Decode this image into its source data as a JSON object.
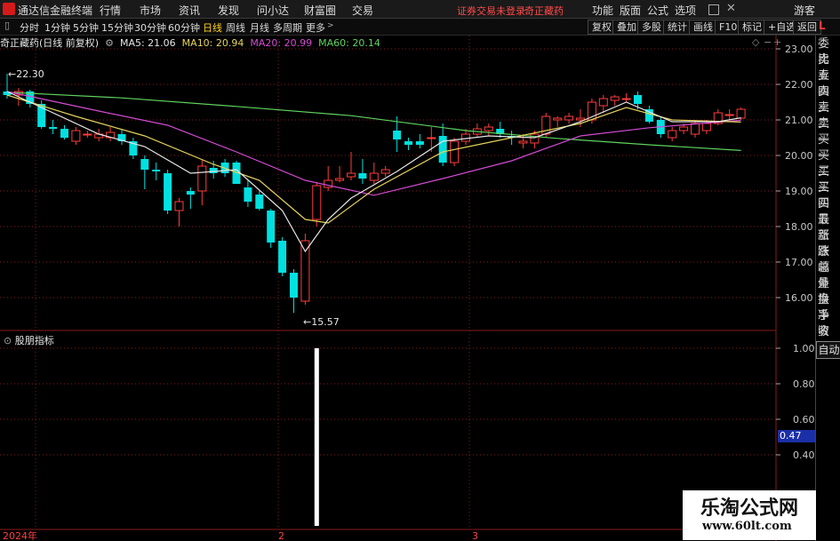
{
  "menubar": {
    "app_name": "通达信金融终端",
    "items": [
      "行情",
      "市场",
      "资讯",
      "发现",
      "问小达",
      "财富圈",
      "交易"
    ],
    "status_text": "证券交易未登录",
    "stock_name": "奇正藏药",
    "right_items": [
      "功能",
      "版面",
      "公式",
      "选项"
    ],
    "guest": "游客"
  },
  "periodbar": {
    "periods": [
      "分时",
      "1分钟",
      "5分钟",
      "15分钟",
      "30分钟",
      "60分钟",
      "日线",
      "周线",
      "月线",
      "多周期",
      "更多"
    ],
    "active": "日线",
    "tools": [
      "复权",
      "叠加",
      "多股",
      "统计",
      "画线",
      "F10",
      "标记",
      "+自选",
      "返回"
    ]
  },
  "chart_header": {
    "title": "奇正藏药(日线 前复权)",
    "ma5": "MA5: 21.06",
    "ma10": "MA10: 20.94",
    "ma20": "MA20: 20.99",
    "ma60": "MA60: 20.14"
  },
  "sidepanel": {
    "marker": "L",
    "items": [
      "委比",
      "卖五",
      "卖四",
      "卖三",
      "卖二",
      "卖一",
      "买一",
      "买二",
      "买三",
      "买四",
      "买五",
      "最新",
      "涨跌",
      "涨幅",
      "总量",
      "外盘",
      "换手",
      "净资",
      "收益"
    ],
    "auto_button": "自动"
  },
  "indicator": {
    "title": "股朋指标",
    "current_value": "0.47",
    "y_ticks": [
      "1.00",
      "0.80",
      "0.60",
      "0.40"
    ],
    "signal_date": "2024-02-05"
  },
  "watermark": {
    "title": "乐淘公式网",
    "url": "www.60lt.com"
  },
  "colors": {
    "up": "#ff3c3c",
    "down": "#00e0e0",
    "ma5": "#e6e6e6",
    "ma10": "#e6d45a",
    "ma20": "#d34bd3",
    "ma60": "#5fd35f",
    "grid": "#8a1a1a"
  },
  "chart_data": {
    "type": "candlestick",
    "y_ticks": [
      "23.00",
      "22.00",
      "21.00",
      "20.00",
      "19.00",
      "18.00",
      "17.00",
      "16.00"
    ],
    "ylim": [
      15.5,
      23.4
    ],
    "x_labels": [
      "2024年",
      "2",
      "3"
    ],
    "high_annotation": "22.30",
    "low_annotation": "15.57",
    "candles": [
      {
        "o": 21.8,
        "h": 22.3,
        "l": 21.6,
        "c": 21.7
      },
      {
        "o": 21.7,
        "h": 21.9,
        "l": 21.4,
        "c": 21.8
      },
      {
        "o": 21.8,
        "h": 21.85,
        "l": 21.35,
        "c": 21.45
      },
      {
        "o": 21.45,
        "h": 21.55,
        "l": 20.75,
        "c": 20.8
      },
      {
        "o": 20.8,
        "h": 21.0,
        "l": 20.6,
        "c": 20.75
      },
      {
        "o": 20.75,
        "h": 20.85,
        "l": 20.45,
        "c": 20.5
      },
      {
        "o": 20.4,
        "h": 20.8,
        "l": 20.3,
        "c": 20.7
      },
      {
        "o": 20.6,
        "h": 20.7,
        "l": 20.5,
        "c": 20.6
      },
      {
        "o": 20.5,
        "h": 20.75,
        "l": 20.4,
        "c": 20.6
      },
      {
        "o": 20.5,
        "h": 20.8,
        "l": 20.4,
        "c": 20.65
      },
      {
        "o": 20.6,
        "h": 20.75,
        "l": 20.3,
        "c": 20.4
      },
      {
        "o": 20.4,
        "h": 20.5,
        "l": 19.9,
        "c": 20.0
      },
      {
        "o": 19.9,
        "h": 20.0,
        "l": 19.05,
        "c": 19.6
      },
      {
        "o": 19.6,
        "h": 19.8,
        "l": 19.3,
        "c": 19.55
      },
      {
        "o": 19.5,
        "h": 19.6,
        "l": 18.35,
        "c": 18.45
      },
      {
        "o": 18.45,
        "h": 18.8,
        "l": 18.0,
        "c": 18.7
      },
      {
        "o": 19.0,
        "h": 19.1,
        "l": 18.5,
        "c": 18.9
      },
      {
        "o": 19.0,
        "h": 19.9,
        "l": 18.6,
        "c": 19.7
      },
      {
        "o": 19.65,
        "h": 19.85,
        "l": 19.35,
        "c": 19.5
      },
      {
        "o": 19.8,
        "h": 19.9,
        "l": 19.4,
        "c": 19.5
      },
      {
        "o": 19.8,
        "h": 19.85,
        "l": 19.2,
        "c": 19.2
      },
      {
        "o": 19.1,
        "h": 19.3,
        "l": 18.55,
        "c": 18.7
      },
      {
        "o": 18.9,
        "h": 19.0,
        "l": 18.45,
        "c": 18.5
      },
      {
        "o": 18.45,
        "h": 18.5,
        "l": 17.4,
        "c": 17.55
      },
      {
        "o": 17.6,
        "h": 17.7,
        "l": 16.6,
        "c": 16.7
      },
      {
        "o": 16.7,
        "h": 16.8,
        "l": 15.57,
        "c": 16.0
      },
      {
        "o": 15.9,
        "h": 17.8,
        "l": 15.8,
        "c": 17.6
      },
      {
        "o": 18.2,
        "h": 19.25,
        "l": 18.0,
        "c": 19.15
      },
      {
        "o": 19.1,
        "h": 19.7,
        "l": 19.0,
        "c": 19.3
      },
      {
        "o": 19.3,
        "h": 19.7,
        "l": 19.25,
        "c": 19.35
      },
      {
        "o": 19.4,
        "h": 20.1,
        "l": 19.3,
        "c": 19.5
      },
      {
        "o": 19.5,
        "h": 19.9,
        "l": 19.2,
        "c": 19.35
      },
      {
        "o": 19.3,
        "h": 19.8,
        "l": 19.2,
        "c": 19.5
      },
      {
        "o": 19.5,
        "h": 19.7,
        "l": 19.4,
        "c": 19.6
      },
      {
        "o": 20.7,
        "h": 21.1,
        "l": 20.1,
        "c": 20.45
      },
      {
        "o": 20.4,
        "h": 20.5,
        "l": 20.15,
        "c": 20.3
      },
      {
        "o": 20.4,
        "h": 20.6,
        "l": 20.2,
        "c": 20.3
      },
      {
        "o": 20.5,
        "h": 20.8,
        "l": 20.1,
        "c": 20.5
      },
      {
        "o": 20.55,
        "h": 20.9,
        "l": 19.7,
        "c": 19.8
      },
      {
        "o": 19.8,
        "h": 20.5,
        "l": 19.7,
        "c": 20.4
      },
      {
        "o": 20.4,
        "h": 20.75,
        "l": 20.3,
        "c": 20.6
      },
      {
        "o": 20.6,
        "h": 20.9,
        "l": 20.5,
        "c": 20.75
      },
      {
        "o": 20.7,
        "h": 20.9,
        "l": 20.55,
        "c": 20.8
      },
      {
        "o": 20.75,
        "h": 20.95,
        "l": 20.5,
        "c": 20.6
      },
      {
        "o": 20.55,
        "h": 20.7,
        "l": 20.3,
        "c": 20.5
      },
      {
        "o": 20.35,
        "h": 20.6,
        "l": 20.2,
        "c": 20.4
      },
      {
        "o": 20.35,
        "h": 20.7,
        "l": 20.2,
        "c": 20.6
      },
      {
        "o": 20.6,
        "h": 21.2,
        "l": 20.5,
        "c": 21.1
      },
      {
        "o": 21.0,
        "h": 21.1,
        "l": 20.8,
        "c": 21.05
      },
      {
        "o": 21.0,
        "h": 21.2,
        "l": 20.9,
        "c": 21.1
      },
      {
        "o": 21.0,
        "h": 21.3,
        "l": 20.8,
        "c": 21.05
      },
      {
        "o": 21.0,
        "h": 21.6,
        "l": 20.9,
        "c": 21.5
      },
      {
        "o": 21.4,
        "h": 21.7,
        "l": 21.2,
        "c": 21.6
      },
      {
        "o": 21.55,
        "h": 21.7,
        "l": 21.4,
        "c": 21.65
      },
      {
        "o": 21.6,
        "h": 21.75,
        "l": 21.5,
        "c": 21.6
      },
      {
        "o": 21.7,
        "h": 21.8,
        "l": 21.3,
        "c": 21.45
      },
      {
        "o": 21.3,
        "h": 21.4,
        "l": 20.9,
        "c": 20.95
      },
      {
        "o": 21.0,
        "h": 21.1,
        "l": 20.5,
        "c": 20.6
      },
      {
        "o": 20.5,
        "h": 20.8,
        "l": 20.4,
        "c": 20.7
      },
      {
        "o": 20.7,
        "h": 20.9,
        "l": 20.6,
        "c": 20.8
      },
      {
        "o": 20.6,
        "h": 21.0,
        "l": 20.5,
        "c": 20.9
      },
      {
        "o": 20.7,
        "h": 21.0,
        "l": 20.6,
        "c": 20.9
      },
      {
        "o": 20.9,
        "h": 21.3,
        "l": 20.85,
        "c": 21.2
      },
      {
        "o": 21.15,
        "h": 21.3,
        "l": 21.0,
        "c": 21.15
      },
      {
        "o": 21.05,
        "h": 21.35,
        "l": 21.0,
        "c": 21.3
      }
    ],
    "ma60": [
      [
        0,
        21.78
      ],
      [
        10,
        21.62
      ],
      [
        20,
        21.38
      ],
      [
        30,
        21.12
      ],
      [
        40,
        20.7
      ],
      [
        48,
        20.48
      ],
      [
        56,
        20.3
      ],
      [
        64,
        20.14
      ]
    ],
    "ma20": [
      [
        0,
        21.8
      ],
      [
        8,
        21.25
      ],
      [
        14,
        20.85
      ],
      [
        20,
        20.1
      ],
      [
        26,
        19.3
      ],
      [
        32,
        18.88
      ],
      [
        38,
        19.35
      ],
      [
        44,
        19.85
      ],
      [
        50,
        20.55
      ],
      [
        56,
        20.78
      ],
      [
        64,
        20.99
      ]
    ],
    "ma10": [
      [
        0,
        21.7
      ],
      [
        6,
        21.1
      ],
      [
        12,
        20.55
      ],
      [
        18,
        19.75
      ],
      [
        22,
        19.3
      ],
      [
        26,
        18.2
      ],
      [
        28,
        18.1
      ],
      [
        32,
        19.05
      ],
      [
        38,
        20.1
      ],
      [
        44,
        20.5
      ],
      [
        50,
        20.9
      ],
      [
        54,
        21.35
      ],
      [
        58,
        21.0
      ],
      [
        64,
        20.94
      ]
    ],
    "ma5": [
      [
        0,
        21.8
      ],
      [
        4,
        21.2
      ],
      [
        8,
        20.6
      ],
      [
        12,
        20.25
      ],
      [
        16,
        19.5
      ],
      [
        20,
        19.6
      ],
      [
        24,
        18.45
      ],
      [
        26,
        17.3
      ],
      [
        28,
        18.2
      ],
      [
        30,
        18.8
      ],
      [
        34,
        19.55
      ],
      [
        38,
        20.4
      ],
      [
        42,
        20.55
      ],
      [
        46,
        20.5
      ],
      [
        50,
        20.95
      ],
      [
        54,
        21.5
      ],
      [
        58,
        20.95
      ],
      [
        62,
        20.95
      ],
      [
        64,
        21.06
      ]
    ]
  }
}
